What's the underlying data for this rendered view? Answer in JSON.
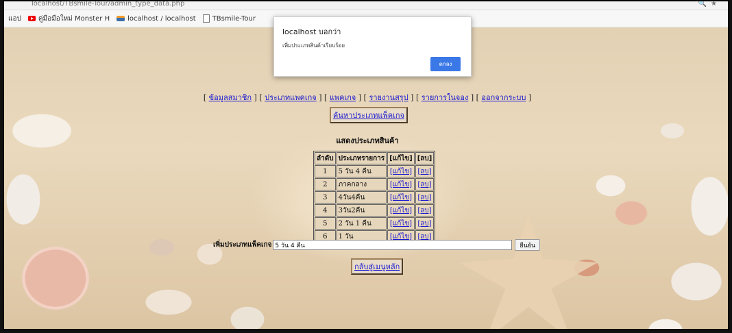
{
  "browser": {
    "url": "localhost/TBsmile-Tour/admin_type_data.php",
    "bookmarks": [
      {
        "label": "แอป"
      },
      {
        "label": "คู่มือมือใหม่ Monster H"
      },
      {
        "label": "localhost / localhost"
      },
      {
        "label": "TBsmile-Tour"
      }
    ]
  },
  "menu": {
    "items": [
      {
        "label": "ข้อมูลสมาชิก"
      },
      {
        "label": "ประเภทแพคเกจ"
      },
      {
        "label": "แพคเกจ"
      },
      {
        "label": "รายงานสรุป"
      },
      {
        "label": "รายการในจอง"
      },
      {
        "label": "ออกจากระบบ"
      }
    ]
  },
  "search_button": "ค้นหาประเภทแพ็คเกจ",
  "heading": "แสดงประเภทสินค้า",
  "table": {
    "headers": [
      "ลำดับ",
      "ประเภทรายการ",
      "[แก้ไข]",
      "[ลบ]"
    ],
    "rows": [
      {
        "no": "1",
        "type": "5 วัน 4 คืน",
        "edit": "[แก้ไข]",
        "delete": "[ลบ]"
      },
      {
        "no": "2",
        "type": "ภาคกลาง",
        "edit": "[แก้ไข]",
        "delete": "[ลบ]"
      },
      {
        "no": "3",
        "type": "4วัน4คืน",
        "edit": "[แก้ไข]",
        "delete": "[ลบ]"
      },
      {
        "no": "4",
        "type": "3วัน2คืน",
        "edit": "[แก้ไข]",
        "delete": "[ลบ]"
      },
      {
        "no": "5",
        "type": "2 วัน 1 คืน",
        "edit": "[แก้ไข]",
        "delete": "[ลบ]"
      },
      {
        "no": "6",
        "type": "1 วัน",
        "edit": "[แก้ไข]",
        "delete": "[ลบ]"
      }
    ]
  },
  "form": {
    "label": "เพิ่มประเภทแพ็คเกจ",
    "value": "5 วัน 4 คืน",
    "submit": "ยืนยัน"
  },
  "back_button": "กลับสู่เมนูหลัก",
  "dialog": {
    "title": "localhost บอกว่า",
    "message": "เพิ่มประเภทสินค้าเรียบร้อย",
    "ok": "ตกลง"
  }
}
